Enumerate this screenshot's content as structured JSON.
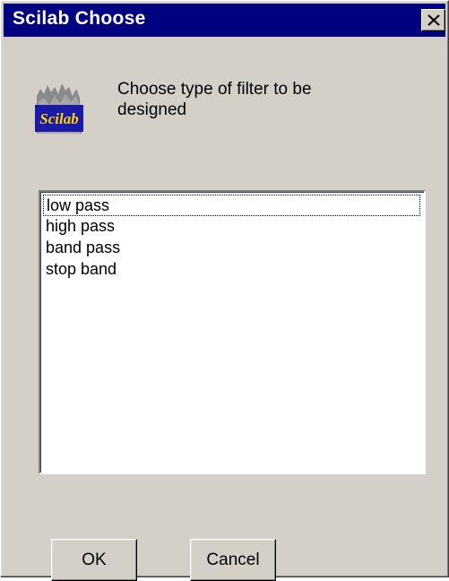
{
  "window": {
    "title": "Scilab Choose",
    "close_icon": "close-icon"
  },
  "logo": {
    "icon": "scilab-logo-icon",
    "text": "Scilab"
  },
  "prompt": {
    "line1": "Choose type of filter to be",
    "line2": "designed"
  },
  "list": {
    "items": [
      "low pass",
      "high pass",
      "band pass",
      "stop band"
    ],
    "focused_index": 0
  },
  "buttons": {
    "ok_label": "OK",
    "cancel_label": "Cancel"
  },
  "colors": {
    "titlebar": "#000080",
    "face": "#d4d0c8"
  }
}
